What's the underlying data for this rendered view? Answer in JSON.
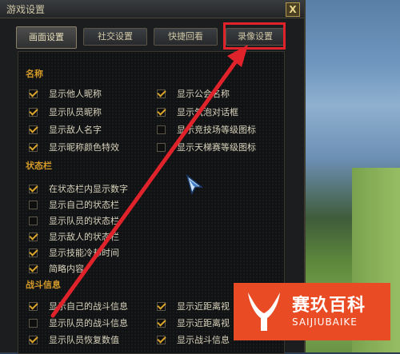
{
  "window": {
    "title": "游戏设置",
    "close_label": "X"
  },
  "tabs": [
    {
      "label": "画面设置",
      "active": true
    },
    {
      "label": "社交设置",
      "active": false
    },
    {
      "label": "快捷回看",
      "active": false
    },
    {
      "label": "录像设置",
      "active": false,
      "highlighted": true
    }
  ],
  "sections": {
    "names": {
      "title": "名称",
      "left": [
        {
          "label": "显示他人昵称",
          "checked": true
        },
        {
          "label": "显示队员昵称",
          "checked": true
        },
        {
          "label": "显示敌人名字",
          "checked": true
        },
        {
          "label": "显示昵称颜色特效",
          "checked": true
        }
      ],
      "right": [
        {
          "label": "显示公会名称",
          "checked": true
        },
        {
          "label": "显示气泡对话框",
          "checked": true
        },
        {
          "label": "显示竞技场等级图标",
          "checked": false
        },
        {
          "label": "显示天梯赛等级图标",
          "checked": false
        }
      ]
    },
    "status": {
      "title": "状态栏",
      "items": [
        {
          "label": "在状态栏内显示数字",
          "checked": true
        },
        {
          "label": "显示自己的状态栏",
          "checked": false
        },
        {
          "label": "显示队员的状态栏",
          "checked": false
        },
        {
          "label": "显示敌人的状态栏",
          "checked": true
        },
        {
          "label": "显示技能冷却时间",
          "checked": true
        },
        {
          "label": "简略内容",
          "checked": true
        }
      ]
    },
    "combat": {
      "title": "战斗信息",
      "left": [
        {
          "label": "显示自己的战斗信息",
          "checked": true
        },
        {
          "label": "显示队员的战斗信息",
          "checked": false
        },
        {
          "label": "显示队员恢复数值",
          "checked": true
        }
      ],
      "right": [
        {
          "label": "显示近距离视",
          "checked": true
        },
        {
          "label": "显示近距离视",
          "checked": true
        },
        {
          "label": "显示战斗信息",
          "checked": true
        }
      ]
    }
  },
  "watermark": {
    "cn": "赛玖百科",
    "en": "SAIJIUBAIKE"
  },
  "colors": {
    "accent": "#d39a2a",
    "highlight": "#e0232b",
    "watermark_bg": "#e94c24"
  }
}
